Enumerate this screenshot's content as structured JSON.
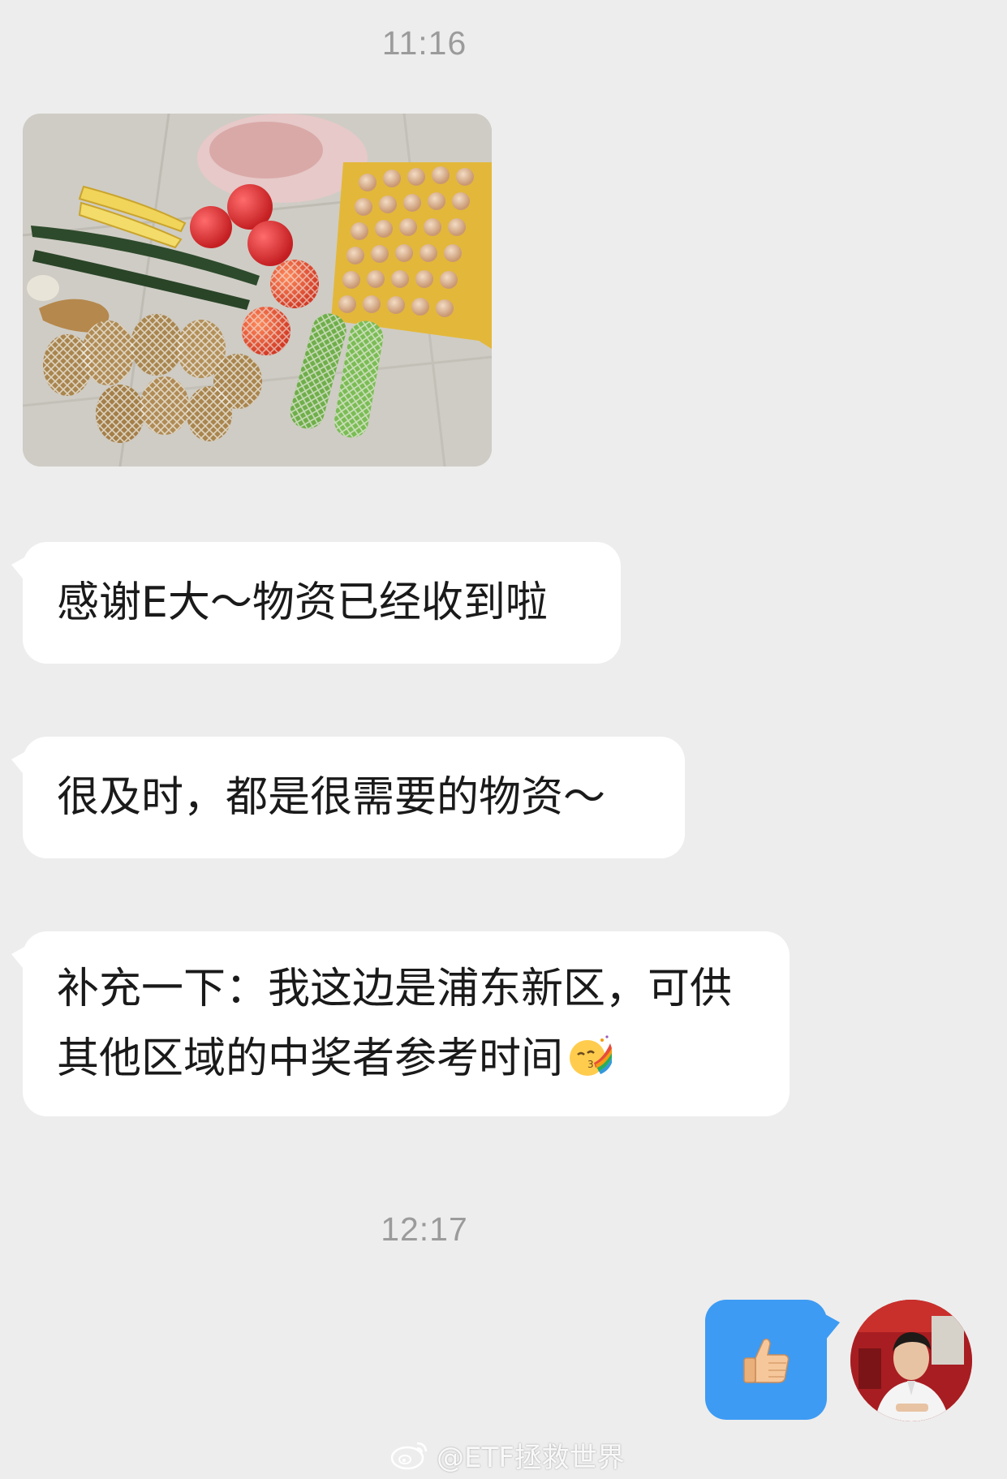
{
  "chat": {
    "timestamps": [
      "11:16",
      "12:17"
    ],
    "messages": [
      {
        "text": "感谢E大～物资已经收到啦"
      },
      {
        "text": "很及时，都是很需要的物资～"
      },
      {
        "text": "补充一下：我这边是浦东新区，可供其他区域的中奖者参考时间"
      }
    ],
    "photo_icon": "groceries-photo",
    "reply_icon": "thumbs-up-icon",
    "inline_emoji_icon": "kissing-rainbow-emoji"
  },
  "watermark": {
    "text": "@ETF拯救世界"
  },
  "colors": {
    "background": "#ededed",
    "incoming_bubble": "#ffffff",
    "outgoing_bubble": "#3d9bf3",
    "timestamp": "#9b9b9b"
  }
}
